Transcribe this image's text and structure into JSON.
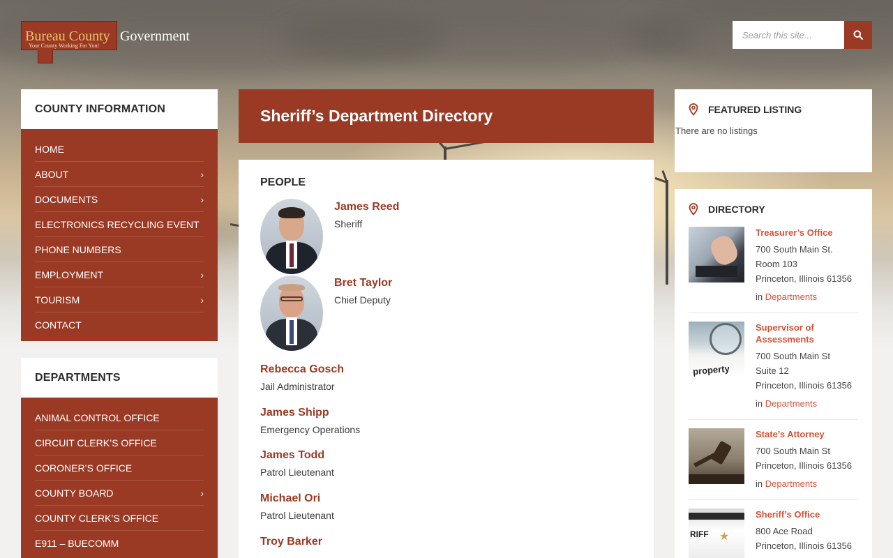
{
  "header": {
    "logo_word1": "Bureau County",
    "logo_word2": "Government",
    "logo_tagline": "Your County Working For You!",
    "search_placeholder": "Search this site..."
  },
  "county_info": {
    "title": "COUNTY INFORMATION",
    "items": [
      {
        "label": "HOME",
        "has_children": false
      },
      {
        "label": "ABOUT",
        "has_children": true
      },
      {
        "label": "DOCUMENTS",
        "has_children": true
      },
      {
        "label": "ELECTRONICS RECYCLING EVENT",
        "has_children": false
      },
      {
        "label": "PHONE NUMBERS",
        "has_children": false
      },
      {
        "label": "EMPLOYMENT",
        "has_children": true
      },
      {
        "label": "TOURISM",
        "has_children": true
      },
      {
        "label": "CONTACT",
        "has_children": false
      }
    ]
  },
  "departments": {
    "title": "DEPARTMENTS",
    "items": [
      {
        "label": "ANIMAL CONTROL OFFICE",
        "has_children": false
      },
      {
        "label": "CIRCUIT CLERK’S OFFICE",
        "has_children": false
      },
      {
        "label": "CORONER’S OFFICE",
        "has_children": false
      },
      {
        "label": "COUNTY BOARD",
        "has_children": true
      },
      {
        "label": "COUNTY CLERK’S OFFICE",
        "has_children": false
      },
      {
        "label": "E911 – BUECOMM",
        "has_children": false
      }
    ]
  },
  "main": {
    "title": "Sheriff’s Department Directory",
    "people_heading": "PEOPLE",
    "people": [
      {
        "name": "James Reed",
        "role": "Sheriff"
      },
      {
        "name": "Bret Taylor",
        "role": "Chief Deputy"
      },
      {
        "name": "Rebecca Gosch",
        "role": "Jail Administrator"
      },
      {
        "name": "James Shipp",
        "role": "Emergency Operations"
      },
      {
        "name": "James Todd",
        "role": "Patrol Lieutenant"
      },
      {
        "name": "Michael Ori",
        "role": "Patrol Lieutenant"
      },
      {
        "name": "Troy Barker",
        "role": ""
      }
    ]
  },
  "featured": {
    "title": "FEATURED LISTING",
    "empty_text": "There are no listings"
  },
  "directory": {
    "title": "DIRECTORY",
    "in_label": "in",
    "items": [
      {
        "name": "Treasurer’s Office",
        "addr": [
          "700 South Main St.",
          "Room 103",
          "Princeton, Illinois 61356"
        ],
        "category": "Departments"
      },
      {
        "name": "Supervisor of Assessments",
        "addr": [
          "700 South Main St",
          "Suite 12",
          "Princeton, Illinois 61356"
        ],
        "category": "Departments",
        "thumb_text": "property"
      },
      {
        "name": "State’s Attorney",
        "addr": [
          "700 South Main St",
          "Princeton, Illinois 61356"
        ],
        "category": "Departments"
      },
      {
        "name": "Sheriff’s Office",
        "addr": [
          "800 Ace Road",
          "Princeton, Illinois 61356"
        ],
        "category": "Departments",
        "thumb_text": "RIFF"
      }
    ]
  },
  "colors": {
    "brand": "#9b3a24",
    "link_accent": "#d65236"
  }
}
